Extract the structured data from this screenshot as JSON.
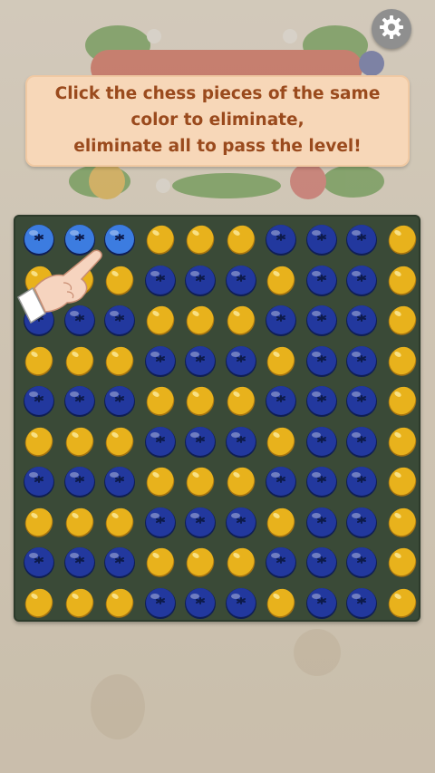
{
  "tutorial": {
    "line1": "Click the chess pieces of the same",
    "line2": "color to eliminate,",
    "line3": "eliminate all to pass the level!"
  },
  "icons": {
    "settings": "gear-icon",
    "blueberry": "blueberry-icon",
    "lemon": "lemon-icon",
    "hand": "pointing-hand-icon"
  },
  "colors": {
    "blueberry": "#22389e",
    "blueberry_highlight": "#3c7ce0",
    "lemon": "#e8b21c",
    "board": "#3a4a37",
    "tip_text": "#9a4a1d"
  },
  "board": {
    "rows": 10,
    "cols": 10,
    "grid": [
      "BBBLLLBBBL",
      "LLLBBBLBBL",
      "BBBLLLBBBL",
      "LLLBBBLBBL",
      "BBBLLLBBBL",
      "LLLBBBLBBL",
      "BBBLLLBBBL",
      "LLLBBBLBBL",
      "BBBLLLBBBL",
      "LLLBBBLBBL"
    ],
    "highlighted": [
      [
        0,
        0
      ],
      [
        0,
        1
      ],
      [
        0,
        2
      ]
    ]
  }
}
